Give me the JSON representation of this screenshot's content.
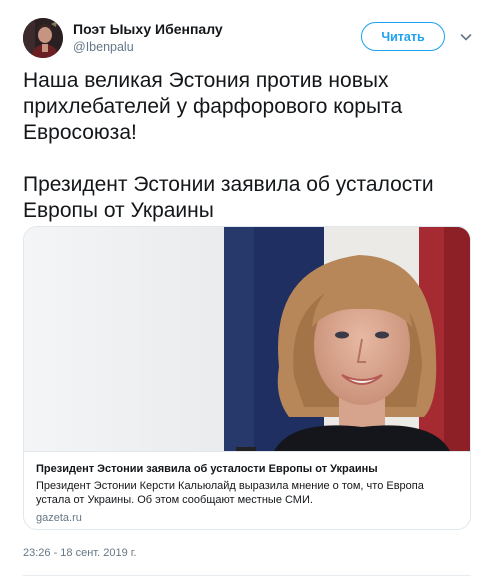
{
  "author": {
    "name": "Поэт Ыыху Ибенпалу",
    "handle": "@Ibenpalu",
    "avatar_icon": "avatar"
  },
  "follow_button": {
    "label": "Читать"
  },
  "menu_icon": "chevron-down-icon",
  "tweet": {
    "paragraph1": "Наша великая Эстония против новых прихлебателей у фарфорового корыта Евросоюза!",
    "paragraph2": "Президент Эстонии заявила об усталости Европы от Украины"
  },
  "card": {
    "title": "Президент Эстонии заявила об усталости Европы от Украины",
    "description": "Президент Эстонии Керсти Кальюлайд выразила мнение о том, что Европа устала от Украины. Об этом сообщают местные СМИ.",
    "domain": "gazeta.ru"
  },
  "timestamp": "23:26 - 18 сент. 2019 г.",
  "colors": {
    "accent": "#1da1f2",
    "text": "#14171a",
    "secondary": "#657786",
    "border": "#e1e8ed"
  }
}
